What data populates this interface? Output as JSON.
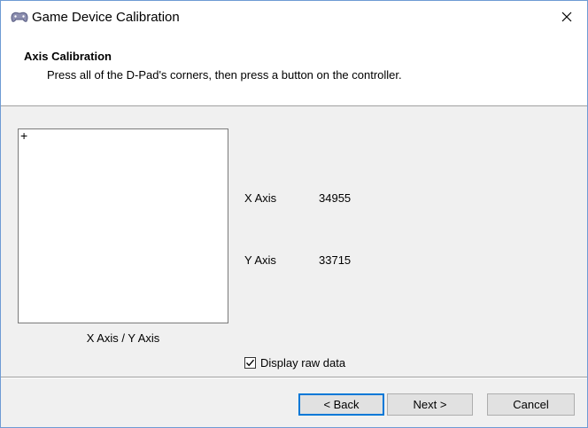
{
  "window": {
    "title": "Game Device Calibration",
    "title_icon": "gamepad-icon",
    "close_icon": "close-icon"
  },
  "header": {
    "title": "Axis Calibration",
    "subtitle": "Press all of the D-Pad's corners, then press a button on the controller."
  },
  "axis_box": {
    "crosshair": "+",
    "label": "X Axis / Y Axis"
  },
  "readouts": {
    "x_label": "X Axis",
    "x_value": "34955",
    "y_label": "Y Axis",
    "y_value": "33715"
  },
  "options": {
    "raw_data_label": "Display raw data",
    "raw_data_checked": true
  },
  "buttons": {
    "back": "< Back",
    "next": "Next >",
    "cancel": "Cancel"
  },
  "colors": {
    "accent": "#0078d7",
    "window_border": "#6e9bd4"
  }
}
